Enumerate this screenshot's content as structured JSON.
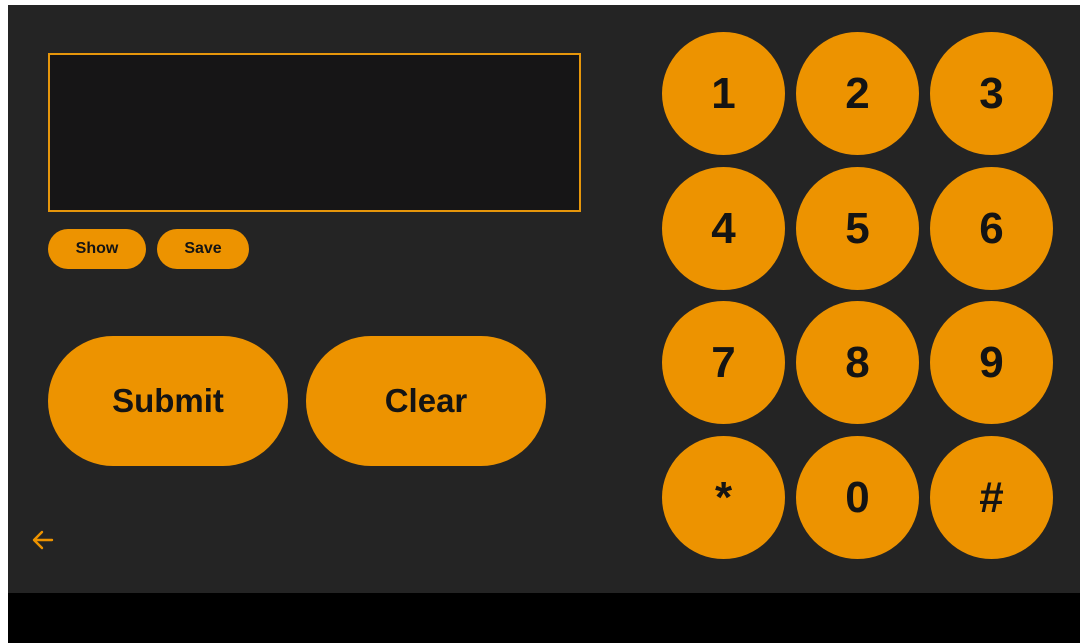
{
  "display": {
    "value": ""
  },
  "actions": {
    "show_label": "Show",
    "save_label": "Save",
    "submit_label": "Submit",
    "clear_label": "Clear"
  },
  "keypad": {
    "keys": [
      "1",
      "2",
      "3",
      "4",
      "5",
      "6",
      "7",
      "8",
      "9",
      "*",
      "0",
      "#"
    ]
  },
  "navigation": {
    "back_icon": "arrow-left-icon"
  },
  "colors": {
    "background": "#242424",
    "accent": "#ED9300",
    "display_background": "#161516",
    "text_on_accent": "#141414",
    "system_bar": "#000000"
  }
}
